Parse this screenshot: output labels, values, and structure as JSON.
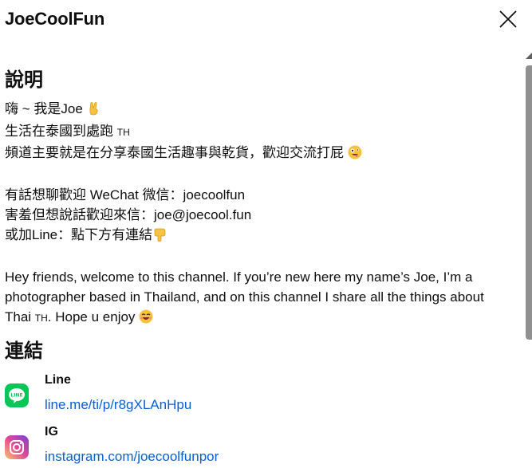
{
  "header": {
    "channel_name": "JoeCoolFun"
  },
  "description": {
    "title": "說明",
    "line1": "嗨 ~ 我是Joe ",
    "line2_text": "生活在泰國到處跑 ",
    "line2_flag": "TH",
    "line3": "頻道主要就是在分享泰國生活趣事與乾貨，歡迎交流打屁 ",
    "line4": "有話想聊歡迎 WeChat 微信：joecoolfun",
    "line5": "害羞但想說話歡迎來信：joe@joecool.fun",
    "line6": "或加Line：點下方有連結",
    "para_start": "Hey friends, welcome to this channel. If you’re new here my name’s Joe, I’m a photographer based in Thailand, and on this channel I share all the things about Thai ",
    "para_flag": "TH",
    "para_end": ". Hope u enjoy "
  },
  "links": {
    "title": "連結",
    "items": [
      {
        "name": "Line",
        "url": "line.me/ti/p/r8gXLAnHpu",
        "icon": "line-icon"
      },
      {
        "name": "IG",
        "url": "instagram.com/joecoolfunpor",
        "icon": "instagram-icon"
      }
    ]
  },
  "icons": {
    "close": "close-icon",
    "victory_emoji": "victory-hand-icon",
    "zany_emoji": "zany-face-icon",
    "pointing_emoji": "pointing-down-icon",
    "grin_emoji": "grinning-face-icon"
  },
  "colors": {
    "link": "#065fd4",
    "line_brand": "#06c755",
    "scrollbar": "#909090"
  }
}
